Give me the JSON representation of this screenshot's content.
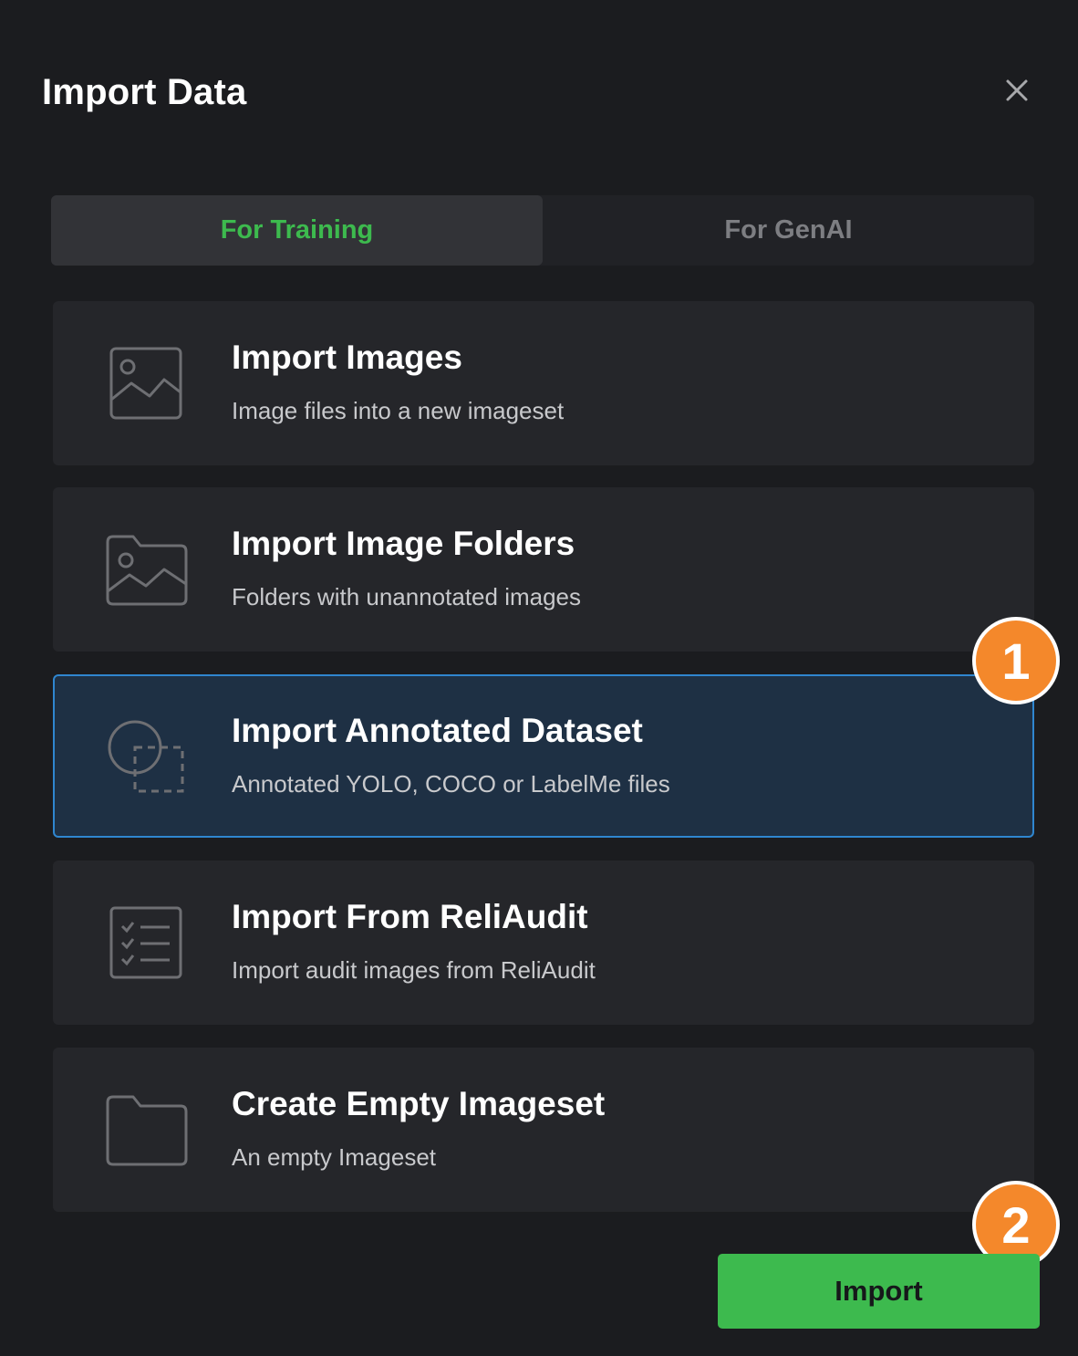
{
  "dialog": {
    "title": "Import Data"
  },
  "tabs": [
    {
      "label": "For Training",
      "active": true
    },
    {
      "label": "For GenAI",
      "active": false
    }
  ],
  "options": [
    {
      "title": "Import Images",
      "description": "Image files into a new imageset",
      "icon": "image-icon",
      "selected": false
    },
    {
      "title": "Import Image Folders",
      "description": "Folders with unannotated images",
      "icon": "image-folder-icon",
      "selected": false
    },
    {
      "title": "Import Annotated Dataset",
      "description": "Annotated YOLO, COCO or LabelMe files",
      "icon": "annotation-shapes-icon",
      "selected": true
    },
    {
      "title": "Import From ReliAudit",
      "description": "Import audit images from ReliAudit",
      "icon": "checklist-icon",
      "selected": false
    },
    {
      "title": "Create Empty Imageset",
      "description": "An empty Imageset",
      "icon": "folder-icon",
      "selected": false
    }
  ],
  "badges": [
    "1",
    "2"
  ],
  "footer": {
    "import_label": "Import"
  },
  "colors": {
    "background": "#1b1c1f",
    "card": "#25262a",
    "selected_card": "#1e3044",
    "selected_border": "#2f86cf",
    "accent_green": "#3dba4e",
    "badge_orange": "#f4882b"
  }
}
